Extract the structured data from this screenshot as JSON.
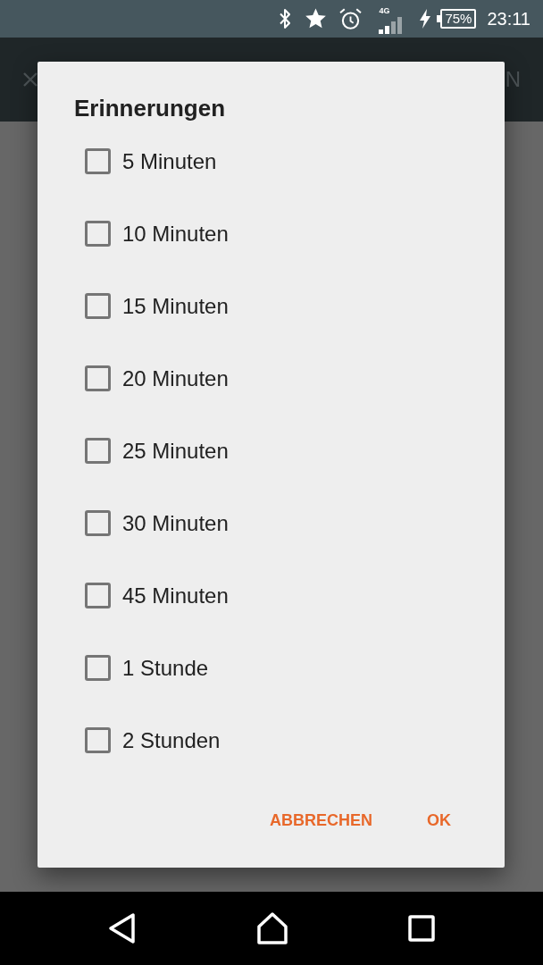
{
  "status_bar": {
    "network_type": "4G",
    "battery": "75%",
    "time": "23:11"
  },
  "app_bar": {
    "action_text": "N"
  },
  "dialog": {
    "title": "Erinnerungen",
    "options": [
      {
        "label": "5 Minuten",
        "checked": false
      },
      {
        "label": "10 Minuten",
        "checked": false
      },
      {
        "label": "15 Minuten",
        "checked": false
      },
      {
        "label": "20 Minuten",
        "checked": false
      },
      {
        "label": "25 Minuten",
        "checked": false
      },
      {
        "label": "30 Minuten",
        "checked": false
      },
      {
        "label": "45 Minuten",
        "checked": false
      },
      {
        "label": "1 Stunde",
        "checked": false
      },
      {
        "label": "2 Stunden",
        "checked": false
      }
    ],
    "buttons": [
      {
        "label": "ABBRECHEN"
      },
      {
        "label": "OK"
      }
    ]
  }
}
